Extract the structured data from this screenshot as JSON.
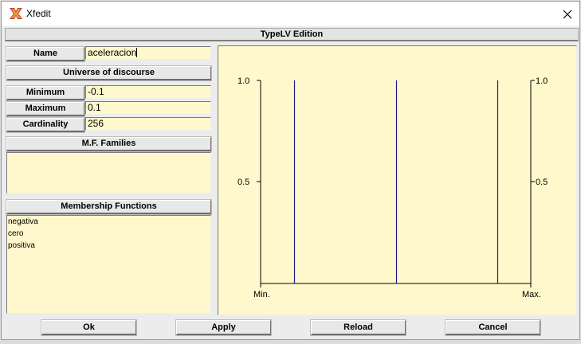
{
  "window": {
    "title": "Xfedit"
  },
  "section_header": "TypeLV Edition",
  "name_row": {
    "label": "Name",
    "value": "aceleracion"
  },
  "universe_button": "Universe of discourse",
  "minimum": {
    "label": "Minimum",
    "value": "-0.1"
  },
  "maximum": {
    "label": "Maximum",
    "value": "0.1"
  },
  "cardinality": {
    "label": "Cardinality",
    "value": "256"
  },
  "mf_families_button": "M.F. Families",
  "mf_families_items": [],
  "membership_functions_button": "Membership Functions",
  "membership_functions": [
    "negativa",
    "cero",
    "positiva"
  ],
  "plot": {
    "y_left_labels": [
      "1.0",
      "0.5"
    ],
    "y_right_labels": [
      "1.0",
      "0.5"
    ],
    "x_min_label": "Min.",
    "x_max_label": "Max.",
    "line_color": "#1a1a8c"
  },
  "chart_data": {
    "type": "line",
    "xlabel": "",
    "ylabel": "",
    "xlim": [
      -0.1,
      0.1
    ],
    "ylim": [
      0,
      1
    ],
    "x_tick_labels": [
      "Min.",
      "Max."
    ],
    "y_tick_labels": [
      "0.5",
      "1.0"
    ],
    "series": [
      {
        "name": "negativa",
        "kind": "singleton",
        "x": -0.075,
        "y": 1.0
      },
      {
        "name": "cero",
        "kind": "singleton",
        "x": 0.0,
        "y": 1.0
      },
      {
        "name": "positiva",
        "kind": "singleton",
        "x": 0.075,
        "y": 1.0
      }
    ]
  },
  "buttons": {
    "ok": "Ok",
    "apply": "Apply",
    "reload": "Reload",
    "cancel": "Cancel"
  },
  "colors": {
    "field_bg": "#fff8cc",
    "window_bg": "#ececec",
    "icon_accent": "#c0392b"
  }
}
